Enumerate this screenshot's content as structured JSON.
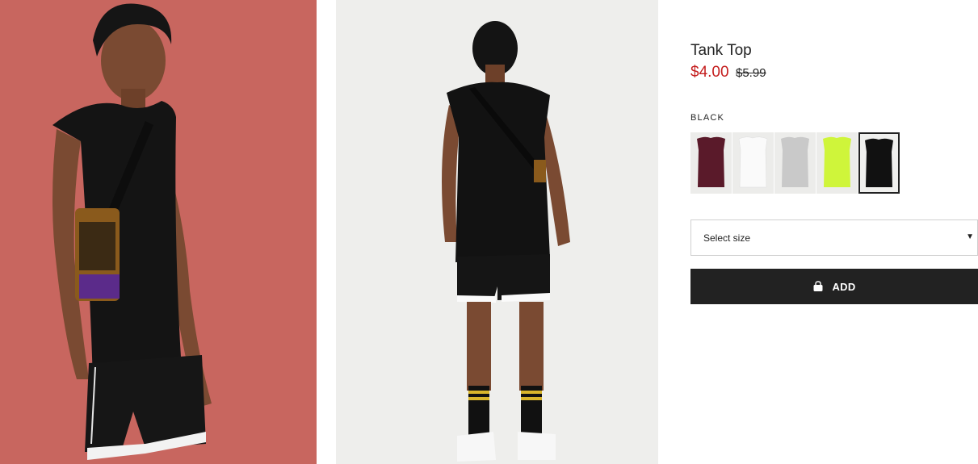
{
  "product": {
    "title": "Tank Top",
    "price_sale": "$4.00",
    "price_original": "$5.99",
    "color_label": "BLACK",
    "swatches": [
      {
        "name": "burgundy",
        "color": "#5a1a2a"
      },
      {
        "name": "white",
        "color": "#f7f7f7"
      },
      {
        "name": "light-grey",
        "color": "#c9c9c9"
      },
      {
        "name": "neon-yellow",
        "color": "#cff53a"
      },
      {
        "name": "black",
        "color": "#111111"
      }
    ],
    "selected_swatch": "black",
    "size_placeholder": "Select size",
    "add_label": "ADD"
  },
  "colors": {
    "sale": "#c41d1d",
    "button": "#222222",
    "photo1_bg": "#c8665f",
    "photo2_bg": "#eeeeec"
  }
}
